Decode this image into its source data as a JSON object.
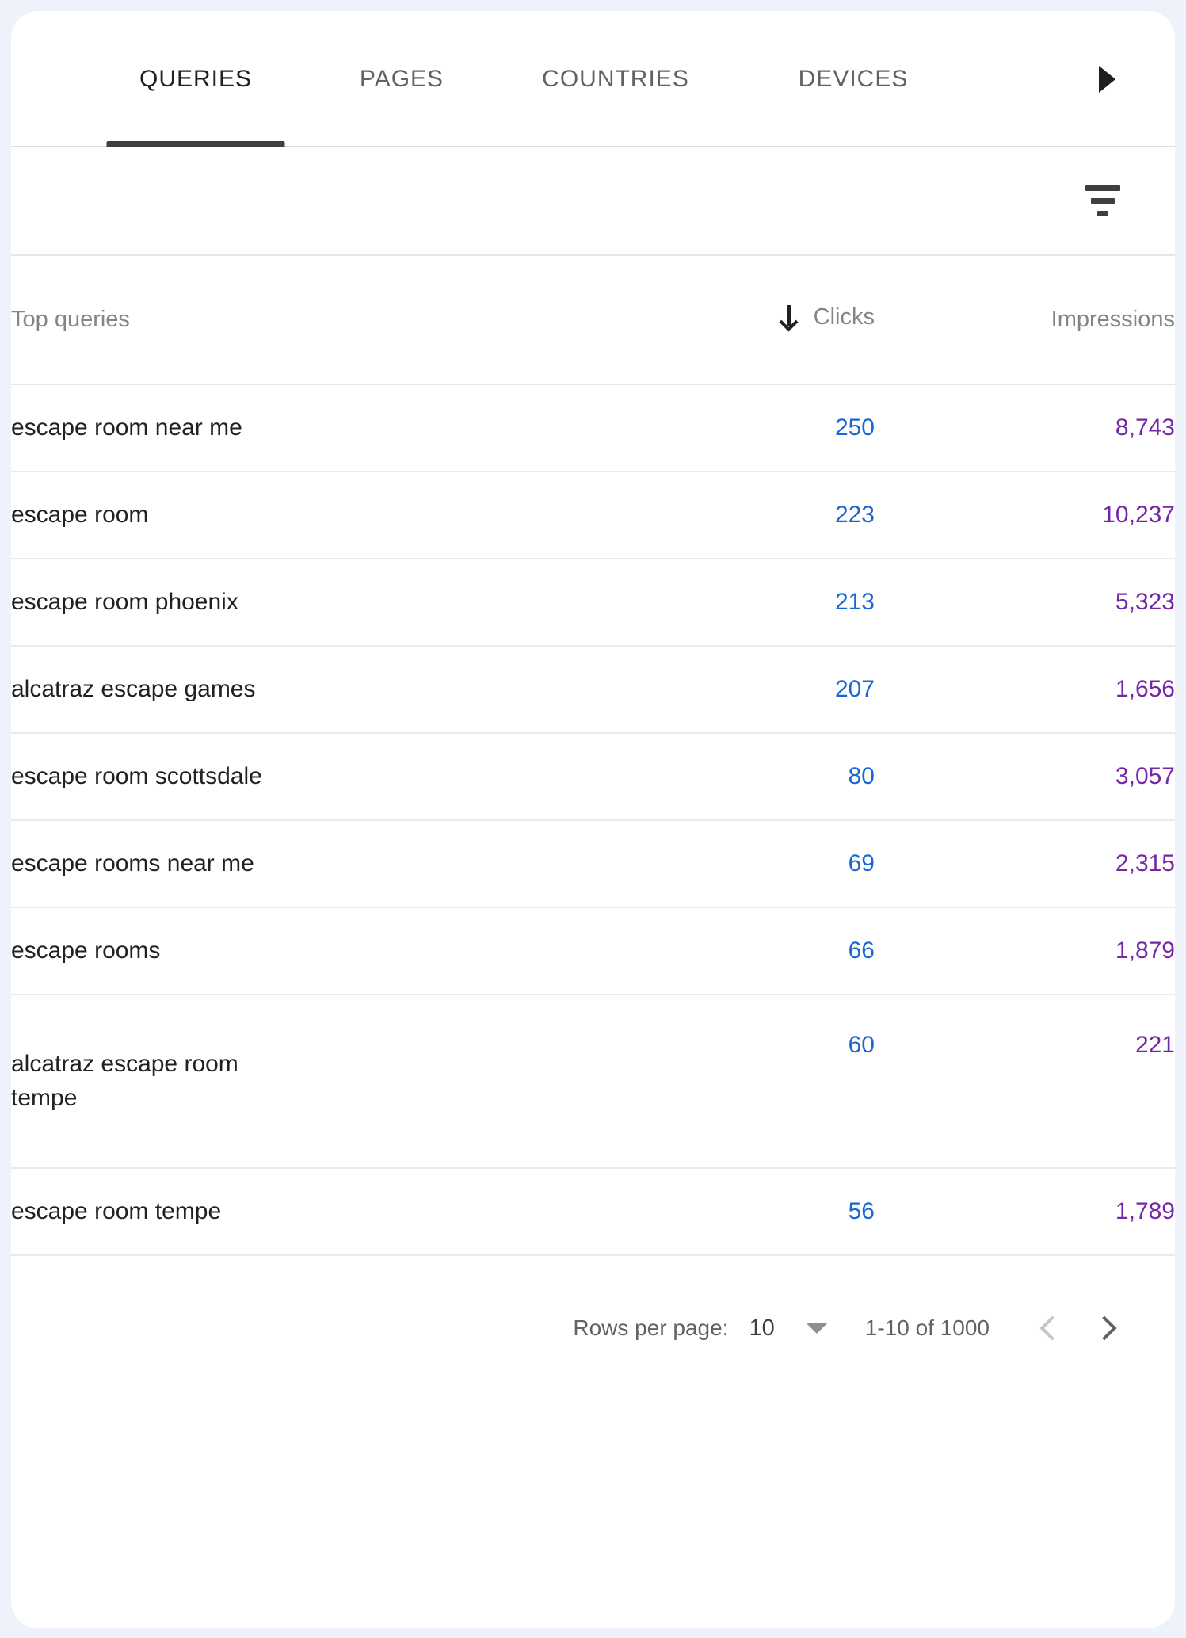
{
  "tabs": [
    {
      "label": "QUERIES",
      "active": true
    },
    {
      "label": "PAGES",
      "active": false
    },
    {
      "label": "COUNTRIES",
      "active": false
    },
    {
      "label": "DEVICES",
      "active": false
    }
  ],
  "tab_scroll_right_icon": "triangle-right-icon",
  "filter_icon": "filter-list-icon",
  "table": {
    "columns": {
      "query": "Top queries",
      "clicks": "Clicks",
      "impressions": "Impressions"
    },
    "sort": {
      "column": "clicks",
      "direction": "desc",
      "icon": "arrow-down-icon"
    },
    "rows": [
      {
        "query": "escape room near me",
        "query_line2": "",
        "clicks": "250",
        "impressions": "8,743"
      },
      {
        "query": "escape room",
        "query_line2": "",
        "clicks": "223",
        "impressions": "10,237"
      },
      {
        "query": "escape room phoenix",
        "query_line2": "",
        "clicks": "213",
        "impressions": "5,323"
      },
      {
        "query": "alcatraz escape games",
        "query_line2": "",
        "clicks": "207",
        "impressions": "1,656"
      },
      {
        "query": "escape room scottsdale",
        "query_line2": "",
        "clicks": "80",
        "impressions": "3,057"
      },
      {
        "query": "escape rooms near me",
        "query_line2": "",
        "clicks": "69",
        "impressions": "2,315"
      },
      {
        "query": "escape rooms",
        "query_line2": "",
        "clicks": "66",
        "impressions": "1,879"
      },
      {
        "query": "alcatraz escape room",
        "query_line2": "tempe",
        "clicks": "60",
        "impressions": "221"
      },
      {
        "query": "escape room tempe",
        "query_line2": "",
        "clicks": "56",
        "impressions": "1,789"
      }
    ]
  },
  "pagination": {
    "rows_per_page_label": "Rows per page:",
    "rows_per_page_value": "10",
    "dropdown_icon": "chevron-down-icon",
    "range_label": "1-10 of 1000",
    "prev_icon": "chevron-left-icon",
    "next_icon": "chevron-right-icon"
  },
  "colors": {
    "page_background": "#eef2fa",
    "card_background": "#ffffff",
    "clicks_value": "#1967d2",
    "impressions_value": "#7627a8",
    "active_tab": "#202124",
    "inactive_tab": "#5f6368",
    "divider": "#e8eaed"
  }
}
